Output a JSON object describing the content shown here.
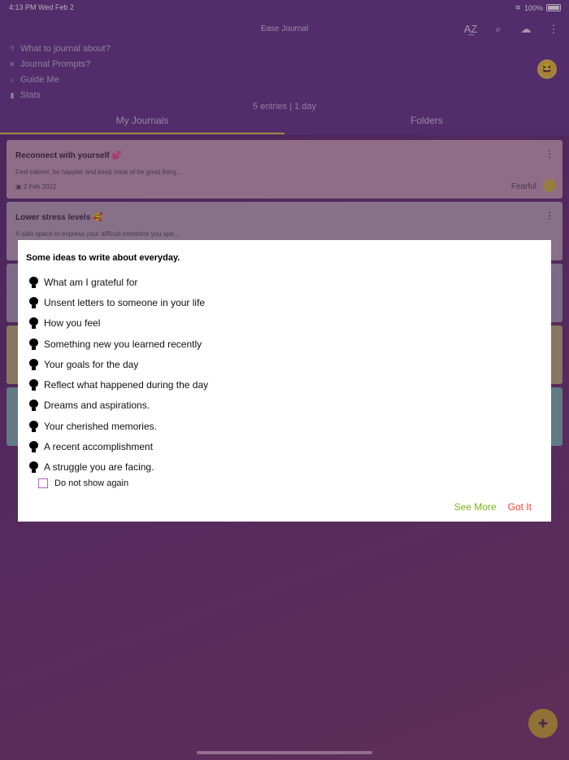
{
  "status": {
    "time": "4:13 PM",
    "date": "Wed Feb 2",
    "battery": "100%"
  },
  "app": {
    "title": "Ease Journal"
  },
  "menu": [
    {
      "label": "What to journal about?",
      "icon": "help-icon"
    },
    {
      "label": "Journal Prompts?",
      "icon": "shuffle-icon"
    },
    {
      "label": "Guide Me",
      "icon": "lightbulb-icon"
    },
    {
      "label": "Stats",
      "icon": "bar-chart-icon"
    }
  ],
  "summary": "5 entries | 1 day",
  "tabs": [
    "My Journals",
    "Folders"
  ],
  "cards": [
    {
      "title": "Reconnect with yourself 💕",
      "desc": "Feel calmer, be happier and keep track of he good thing...",
      "date": "2 Feb 2022",
      "mood": "Fearful",
      "color": "#c79db4"
    },
    {
      "title": "Lower stress levels 🥰",
      "desc": "A safe space to express your difficult emotions you spe...",
      "color": "#b9a3b9"
    }
  ],
  "dialog": {
    "heading": "Some ideas to write about everyday.",
    "ideas": [
      "What am I grateful for",
      "Unsent letters to someone in your life",
      "How you feel",
      "Something new you learned recently",
      "Your goals for the day",
      "Reflect what happened during the day",
      "Dreams and aspirations.",
      "Your cherished memories.",
      "A recent accomplishment",
      "A struggle you are facing."
    ],
    "checkbox_label": "Do not show again",
    "see_more": "See More",
    "got_it": "Got It"
  }
}
